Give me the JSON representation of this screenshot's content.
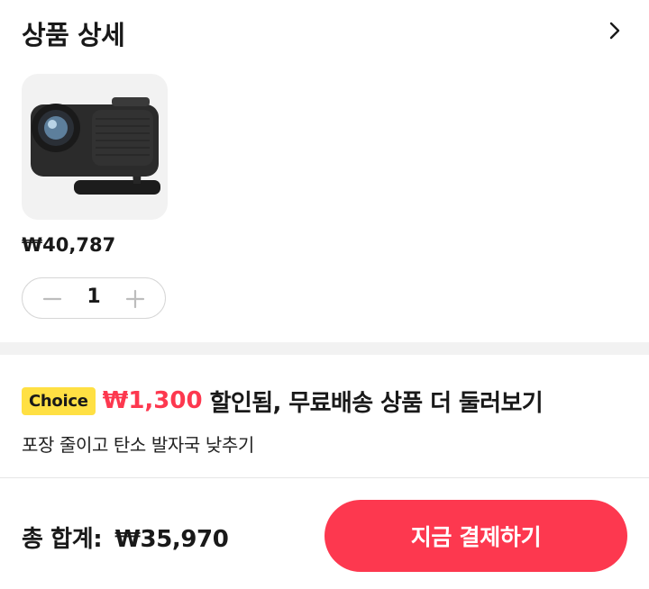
{
  "header": {
    "title": "상품 상세",
    "chevron_icon": "chevron-right-icon"
  },
  "product": {
    "image_icon": "projector-image",
    "price": "₩40,787",
    "quantity": "1",
    "minus_icon": "minus-icon",
    "plus_icon": "plus-icon"
  },
  "promo": {
    "badge": "Choice",
    "amount": "₩1,300",
    "text": "할인됨, 무료배송 상품 더 둘러보기",
    "subtext": "포장 줄이고 탄소 발자국 낮추기"
  },
  "footer": {
    "total_label": "총 합계:",
    "total_value": "₩35,970",
    "pay_button": "지금 결제하기"
  },
  "colors": {
    "accent": "#fd384f",
    "badge_bg": "#ffe043",
    "divider": "#f2f2f2"
  }
}
